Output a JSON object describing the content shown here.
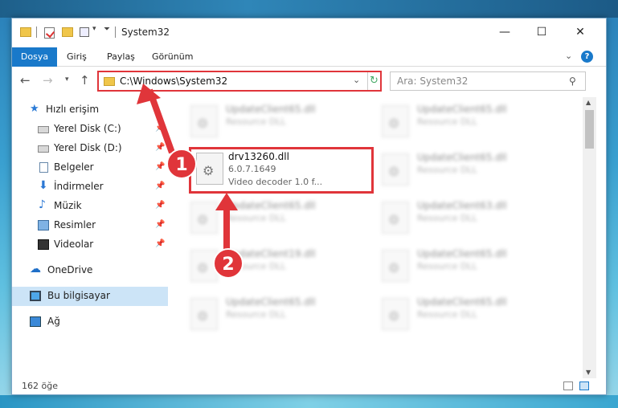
{
  "window": {
    "title": "System32",
    "controls": {
      "minimize": "—",
      "maximize": "☐",
      "close": "✕"
    }
  },
  "ribbon": {
    "tabs": [
      "Dosya",
      "Giriş",
      "Paylaş",
      "Görünüm"
    ],
    "help": "?"
  },
  "navigation": {
    "address": "C:\\Windows\\System32",
    "search_placeholder": "Ara: System32"
  },
  "sidebar": {
    "items": [
      {
        "label": "Hızlı erişim",
        "icon": "star-icon"
      },
      {
        "label": "Yerel Disk (C:)",
        "icon": "disk-icon",
        "pinned": true
      },
      {
        "label": "Yerel Disk (D:)",
        "icon": "disk-icon",
        "pinned": true
      },
      {
        "label": "Belgeler",
        "icon": "document-icon",
        "pinned": true
      },
      {
        "label": "İndirmeler",
        "icon": "download-icon",
        "pinned": true
      },
      {
        "label": "Müzik",
        "icon": "music-icon",
        "pinned": true
      },
      {
        "label": "Resimler",
        "icon": "picture-icon",
        "pinned": true
      },
      {
        "label": "Videolar",
        "icon": "video-icon",
        "pinned": true
      },
      {
        "label": "OneDrive",
        "icon": "cloud-icon"
      },
      {
        "label": "Bu bilgisayar",
        "icon": "computer-icon",
        "selected": true
      },
      {
        "label": "Ağ",
        "icon": "network-icon"
      }
    ]
  },
  "files": {
    "highlighted": {
      "name": "drv13260.dll",
      "version": "6.0.7.1649",
      "description": "Video decoder 1.0 f..."
    },
    "blurred": [
      {
        "name": "UpdateClient65.dll",
        "desc": "Resource DLL"
      },
      {
        "name": "UpdateClient65.dll",
        "desc": "Resource DLL"
      },
      {
        "name": "UpdateClient65.dll",
        "desc": "Resource DLL"
      },
      {
        "name": "UpdateClient65.dll",
        "desc": "Resource DLL"
      },
      {
        "name": "UpdateClient65.dll",
        "desc": "Resource DLL"
      },
      {
        "name": "UpdateClient63.dll",
        "desc": "Resource DLL"
      },
      {
        "name": "UpdateClient19.dll",
        "desc": "Resource DLL"
      },
      {
        "name": "UpdateClient65.dll",
        "desc": "Resource DLL"
      },
      {
        "name": "UpdateClient65.dll",
        "desc": "Resource DLL"
      },
      {
        "name": "UpdateClient65.dll",
        "desc": "Resource DLL"
      }
    ]
  },
  "status": {
    "item_count": "162 öğe"
  },
  "annotations": {
    "step1": "1",
    "step2": "2"
  },
  "colors": {
    "highlight": "#e0353a",
    "accent": "#1979ca",
    "selected": "#cce4f7"
  }
}
